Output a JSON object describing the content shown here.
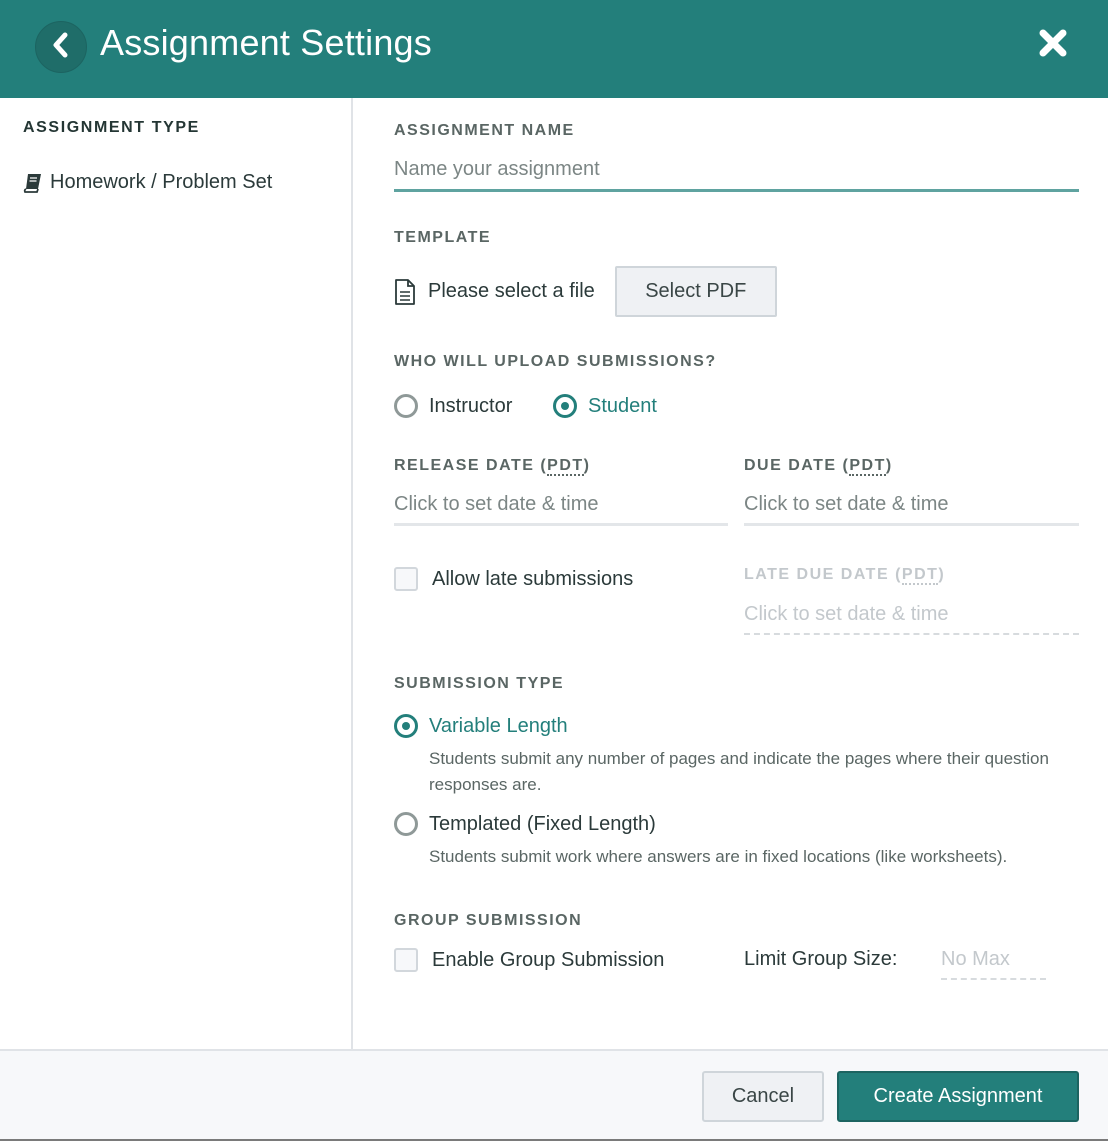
{
  "header": {
    "title": "Assignment Settings",
    "back_icon": "chevron-left-icon",
    "close_icon": "close-icon"
  },
  "sidebar": {
    "heading": "ASSIGNMENT TYPE",
    "items": [
      {
        "label": "Homework / Problem Set",
        "icon": "book-icon"
      }
    ]
  },
  "form": {
    "assignment_name": {
      "label": "ASSIGNMENT NAME",
      "value": "",
      "placeholder": "Name your assignment"
    },
    "template": {
      "label": "TEMPLATE",
      "file_icon": "file-text-icon",
      "file_status": "Please select a file",
      "select_button": "Select PDF"
    },
    "uploader": {
      "label": "WHO WILL UPLOAD SUBMISSIONS?",
      "options": [
        {
          "label": "Instructor",
          "checked": false
        },
        {
          "label": "Student",
          "checked": true
        }
      ]
    },
    "release_date": {
      "label_prefix": "RELEASE DATE (",
      "tz": "PDT",
      "label_suffix": ")",
      "placeholder": "Click to set date & time"
    },
    "due_date": {
      "label_prefix": "DUE DATE (",
      "tz": "PDT",
      "label_suffix": ")",
      "placeholder": "Click to set date & time"
    },
    "allow_late": {
      "label": "Allow late submissions",
      "checked": false
    },
    "late_due_date": {
      "label_prefix": "LATE DUE DATE (",
      "tz": "PDT",
      "label_suffix": ")",
      "placeholder": "Click to set date & time",
      "disabled": true
    },
    "submission_type": {
      "label": "SUBMISSION TYPE",
      "options": [
        {
          "label": "Variable Length",
          "checked": true,
          "description": "Students submit any number of pages and indicate the pages where their question responses are."
        },
        {
          "label": "Templated (Fixed Length)",
          "checked": false,
          "description": "Students submit work where answers are in fixed locations (like worksheets)."
        }
      ]
    },
    "group_submission": {
      "label": "GROUP SUBMISSION",
      "enable_label": "Enable Group Submission",
      "checked": false,
      "limit_label": "Limit Group Size:",
      "limit_placeholder": "No Max"
    }
  },
  "footer": {
    "cancel": "Cancel",
    "create": "Create Assignment"
  },
  "colors": {
    "brand": "#237f7b",
    "header_bg": "#237f7b",
    "input_focus": "#5fa3a0",
    "footer_bg": "#f7f8fa"
  }
}
